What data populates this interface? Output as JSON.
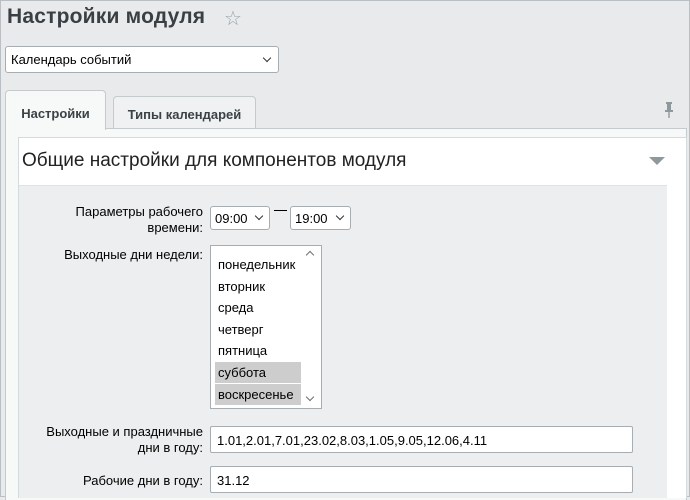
{
  "page": {
    "title": "Настройки модуля"
  },
  "module_select": {
    "value": "Календарь событий"
  },
  "tabs": [
    {
      "label": "Настройки",
      "active": true
    },
    {
      "label": "Типы календарей",
      "active": false
    }
  ],
  "section": {
    "title": "Общие настройки для компонентов модуля"
  },
  "form": {
    "work_time": {
      "label_line1": "Параметры рабочего",
      "label_line2": "времени:",
      "from": "09:00",
      "to": "19:00"
    },
    "weekends": {
      "label": "Выходные дни недели:",
      "options": [
        {
          "label": "понедельник",
          "selected": false
        },
        {
          "label": "вторник",
          "selected": false
        },
        {
          "label": "среда",
          "selected": false
        },
        {
          "label": "четверг",
          "selected": false
        },
        {
          "label": "пятница",
          "selected": false
        },
        {
          "label": "суббота",
          "selected": true
        },
        {
          "label": "воскресенье",
          "selected": true
        }
      ]
    },
    "holidays": {
      "label_line1": "Выходные и праздничные",
      "label_line2": "дни в году:",
      "value": "1.01,2.01,7.01,23.02,8.03,1.05,9.05,12.06,4.11"
    },
    "workdays": {
      "label": "Рабочие дни в году:",
      "value": "31.12"
    }
  },
  "colors": {
    "background": "#e8eaeb",
    "selected_option": "#cdcdcd",
    "title": "#3a3f44"
  },
  "icons": [
    "star-icon",
    "chevron-down-icon",
    "pin-icon",
    "collapse-arrow-icon"
  ]
}
